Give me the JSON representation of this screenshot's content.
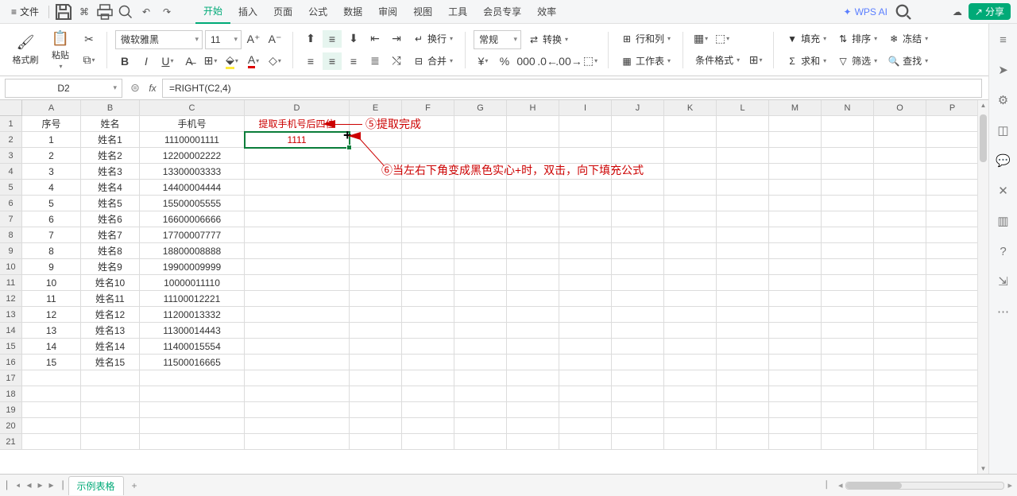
{
  "menubar": {
    "file": "文件",
    "tabs": [
      "开始",
      "插入",
      "页面",
      "公式",
      "数据",
      "审阅",
      "视图",
      "工具",
      "会员专享",
      "效率"
    ],
    "active_tab": 0,
    "wps_ai": "WPS AI",
    "share": "分享"
  },
  "ribbon": {
    "format_painter": "格式刷",
    "paste": "粘贴",
    "font_name": "微软雅黑",
    "font_size": "11",
    "wrap": "换行",
    "merge": "合并",
    "number_format": "常规",
    "convert": "转换",
    "rowcol": "行和列",
    "worksheet": "工作表",
    "cond_format": "条件格式",
    "fill": "填充",
    "sum": "求和",
    "sort": "排序",
    "freeze": "冻结",
    "filter": "筛选",
    "find": "查找"
  },
  "namebox": "D2",
  "formula": "=RIGHT(C2,4)",
  "columns": [
    "A",
    "B",
    "C",
    "D",
    "E",
    "F",
    "G",
    "H",
    "I",
    "J",
    "K",
    "L",
    "M",
    "N",
    "O",
    "P"
  ],
  "headers": {
    "a": "序号",
    "b": "姓名",
    "c": "手机号",
    "d": "提取手机号后四位"
  },
  "rows": [
    {
      "n": "1",
      "name": "姓名1",
      "phone": "11100001111",
      "ext": "1111"
    },
    {
      "n": "2",
      "name": "姓名2",
      "phone": "12200002222"
    },
    {
      "n": "3",
      "name": "姓名3",
      "phone": "13300003333"
    },
    {
      "n": "4",
      "name": "姓名4",
      "phone": "14400004444"
    },
    {
      "n": "5",
      "name": "姓名5",
      "phone": "15500005555"
    },
    {
      "n": "6",
      "name": "姓名6",
      "phone": "16600006666"
    },
    {
      "n": "7",
      "name": "姓名7",
      "phone": "17700007777"
    },
    {
      "n": "8",
      "name": "姓名8",
      "phone": "18800008888"
    },
    {
      "n": "9",
      "name": "姓名9",
      "phone": "19900009999"
    },
    {
      "n": "10",
      "name": "姓名10",
      "phone": "10000011110"
    },
    {
      "n": "11",
      "name": "姓名11",
      "phone": "11100012221"
    },
    {
      "n": "12",
      "name": "姓名12",
      "phone": "11200013332"
    },
    {
      "n": "13",
      "name": "姓名13",
      "phone": "11300014443"
    },
    {
      "n": "14",
      "name": "姓名14",
      "phone": "11400015554"
    },
    {
      "n": "15",
      "name": "姓名15",
      "phone": "11500016665"
    }
  ],
  "annotation1": "⑤提取完成",
  "annotation2": "⑥当左右下角变成黑色实心+时，双击，向下填充公式",
  "sheet_tab": "示例表格"
}
